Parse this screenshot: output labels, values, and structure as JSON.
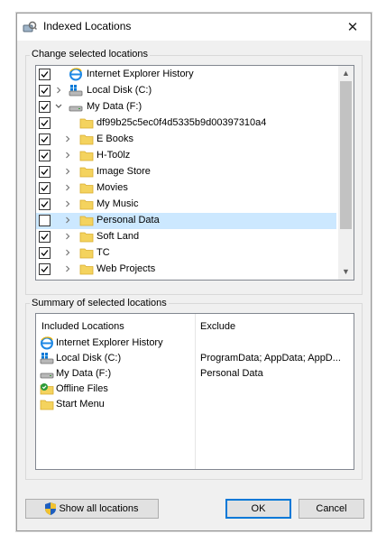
{
  "window": {
    "title": "Indexed Locations",
    "close_glyph": "✕"
  },
  "change_group": {
    "label": "Change selected locations",
    "tree": [
      {
        "label": "Internet Explorer History",
        "checked": true,
        "indent": 0,
        "expander": "none",
        "icon": "ie-history-icon"
      },
      {
        "label": "Local Disk (C:)",
        "checked": true,
        "indent": 0,
        "expander": "collapsed",
        "icon": "drive-windows-icon"
      },
      {
        "label": "My Data (F:)",
        "checked": true,
        "indent": 0,
        "expander": "expanded",
        "icon": "drive-icon"
      },
      {
        "label": "df99b25c5ec0f4d5335b9d00397310a4",
        "checked": true,
        "indent": 1,
        "expander": "none",
        "icon": "folder-icon"
      },
      {
        "label": "E Books",
        "checked": true,
        "indent": 1,
        "expander": "collapsed",
        "icon": "folder-icon"
      },
      {
        "label": "H-To0lz",
        "checked": true,
        "indent": 1,
        "expander": "collapsed",
        "icon": "folder-icon"
      },
      {
        "label": "Image Store",
        "checked": true,
        "indent": 1,
        "expander": "collapsed",
        "icon": "folder-icon"
      },
      {
        "label": "Movies",
        "checked": true,
        "indent": 1,
        "expander": "collapsed",
        "icon": "folder-icon"
      },
      {
        "label": "My Music",
        "checked": true,
        "indent": 1,
        "expander": "collapsed",
        "icon": "folder-icon"
      },
      {
        "label": "Personal Data",
        "checked": false,
        "indent": 1,
        "expander": "collapsed",
        "icon": "folder-icon",
        "selected": true
      },
      {
        "label": "Soft Land",
        "checked": true,
        "indent": 1,
        "expander": "collapsed",
        "icon": "folder-icon"
      },
      {
        "label": "TC",
        "checked": true,
        "indent": 1,
        "expander": "collapsed",
        "icon": "folder-icon"
      },
      {
        "label": "Web Projects",
        "checked": true,
        "indent": 1,
        "expander": "collapsed",
        "icon": "folder-icon"
      }
    ],
    "scroll_up_glyph": "▲",
    "scroll_down_glyph": "▼"
  },
  "summary_group": {
    "label": "Summary of selected locations",
    "col_included": "Included Locations",
    "col_exclude": "Exclude",
    "rows": [
      {
        "location": "Internet Explorer History",
        "exclude": "",
        "icon": "ie-history-icon"
      },
      {
        "location": "Local Disk (C:)",
        "exclude": "ProgramData; AppData; AppD...",
        "icon": "drive-windows-icon"
      },
      {
        "location": "My Data (F:)",
        "exclude": "Personal Data",
        "icon": "drive-icon"
      },
      {
        "location": "Offline Files",
        "exclude": "",
        "icon": "offline-files-icon"
      },
      {
        "location": "Start Menu",
        "exclude": "",
        "icon": "folder-icon"
      }
    ]
  },
  "buttons": {
    "show_all": "Show all locations",
    "ok": "OK",
    "cancel": "Cancel"
  },
  "colors": {
    "selection": "#cce8ff",
    "folder": "#f4d35e",
    "accent": "#0078d7"
  }
}
